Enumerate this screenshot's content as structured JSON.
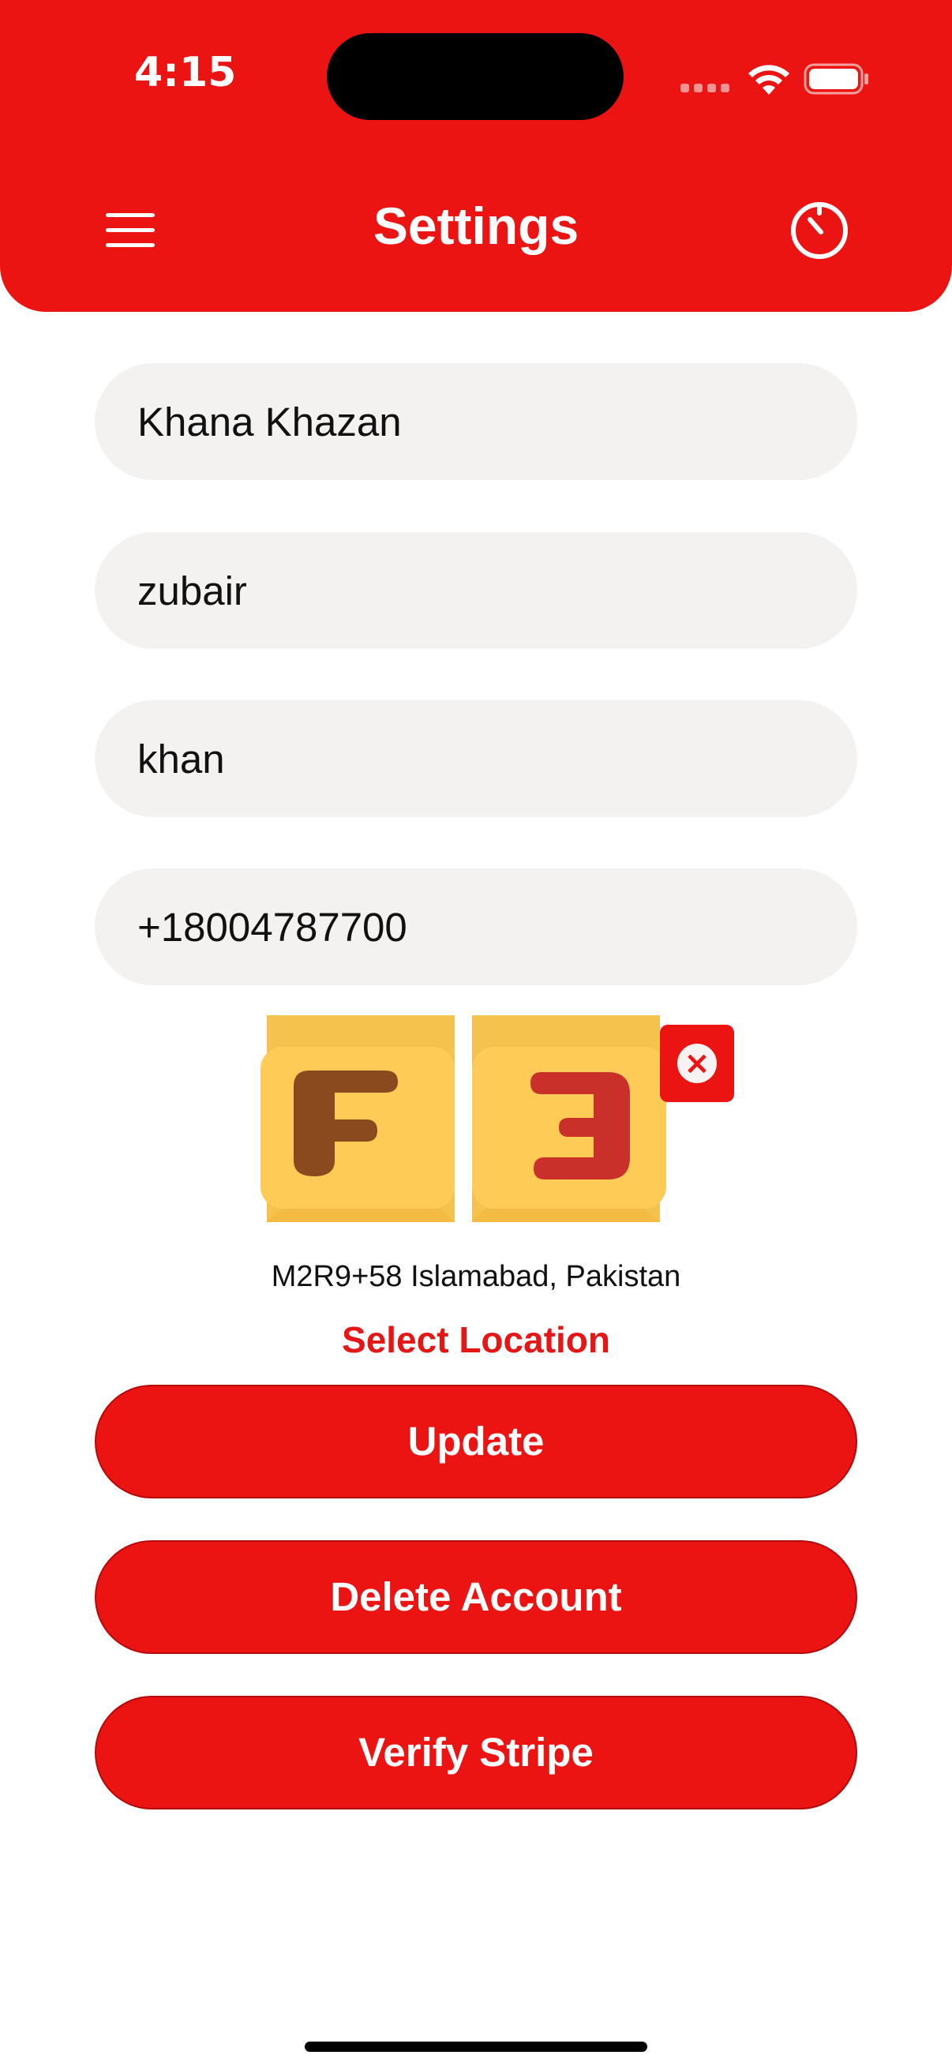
{
  "status_bar": {
    "time": "4:15",
    "icons": [
      "cellular-signal-icon",
      "wifi-icon",
      "battery-icon"
    ]
  },
  "header": {
    "title": "Settings",
    "menu_icon": "hamburger-menu-icon",
    "right_icon": "timer-icon"
  },
  "form": {
    "fields": [
      {
        "name": "restaurant-name-field",
        "value": "Khana Khazan"
      },
      {
        "name": "first-name-field",
        "value": "zubair"
      },
      {
        "name": "last-name-field",
        "value": "khan"
      },
      {
        "name": "phone-field",
        "value": "+18004787700"
      }
    ]
  },
  "logo": {
    "remove_icon": "close-icon"
  },
  "location": {
    "address": "M2R9+58 Islamabad, Pakistan",
    "select_label": "Select Location"
  },
  "actions": {
    "update_label": "Update",
    "delete_label": "Delete Account",
    "verify_label": "Verify Stripe"
  },
  "colors": {
    "primary": "#ec1313",
    "field_bg": "#f3f2f1",
    "logo_yellow": "#fecb57",
    "logo_brown": "#8b4a1e",
    "logo_red": "#c9302a"
  }
}
